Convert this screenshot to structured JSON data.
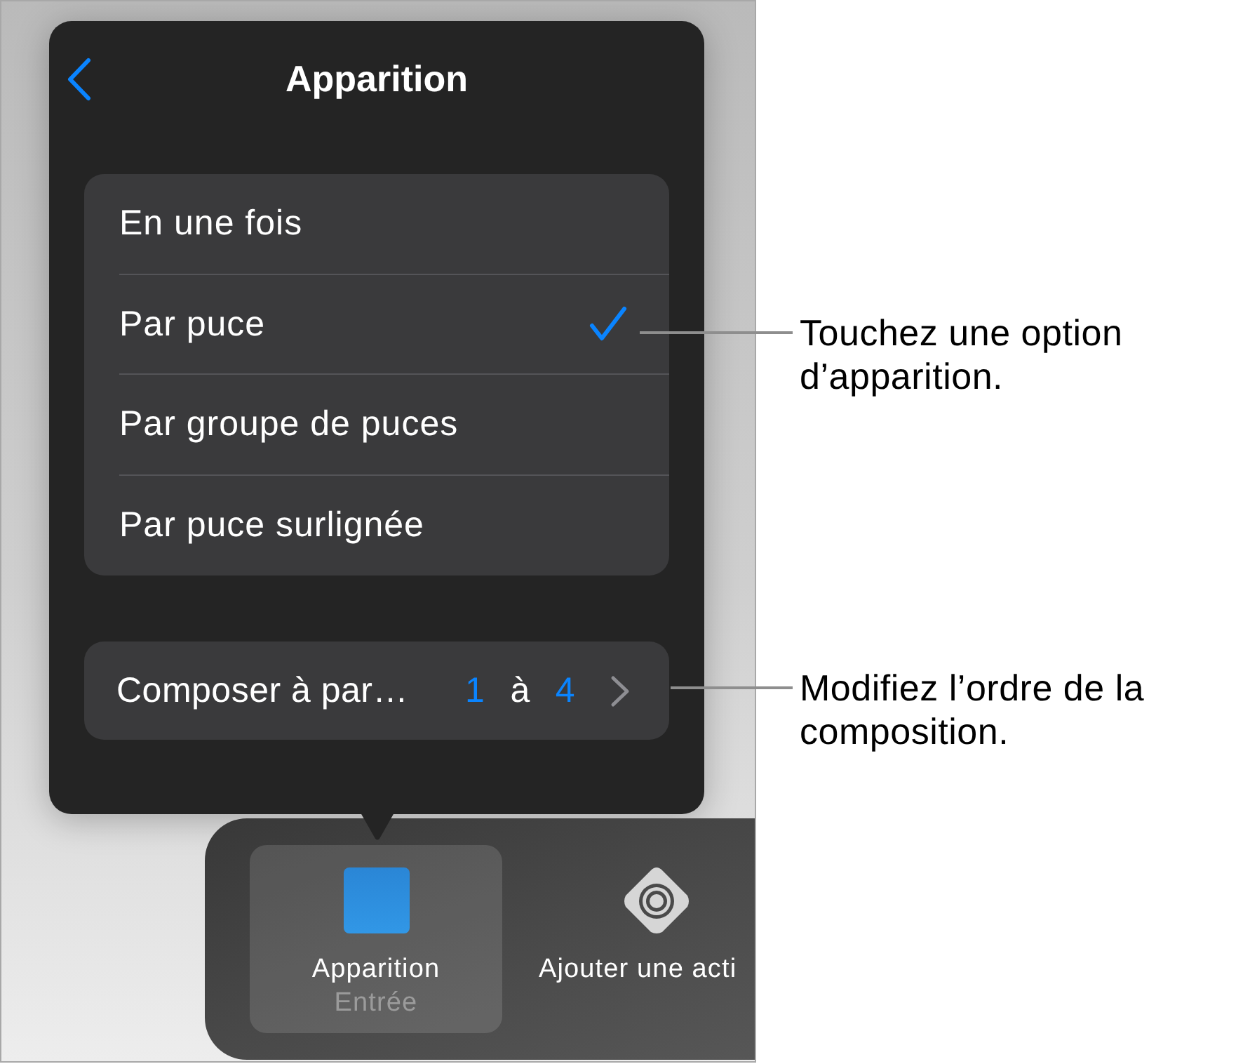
{
  "popover": {
    "title": "Apparition"
  },
  "options": [
    {
      "label": "En une fois",
      "selected": false
    },
    {
      "label": "Par puce",
      "selected": true
    },
    {
      "label": "Par groupe de puces",
      "selected": false
    },
    {
      "label": "Par puce surlignée",
      "selected": false
    }
  ],
  "build_order": {
    "label": "Composer à par…",
    "from": "1",
    "separator": "à",
    "to": "4"
  },
  "toolbar": {
    "items": [
      {
        "kind": "effect",
        "label": "Apparition",
        "sublabel": "Entrée",
        "selected": true
      },
      {
        "kind": "action",
        "label": "Ajouter une acti",
        "selected": false
      }
    ]
  },
  "callouts": [
    {
      "text": "Touchez une option d’apparition."
    },
    {
      "text": "Modifiez l’ordre de la composition."
    }
  ]
}
